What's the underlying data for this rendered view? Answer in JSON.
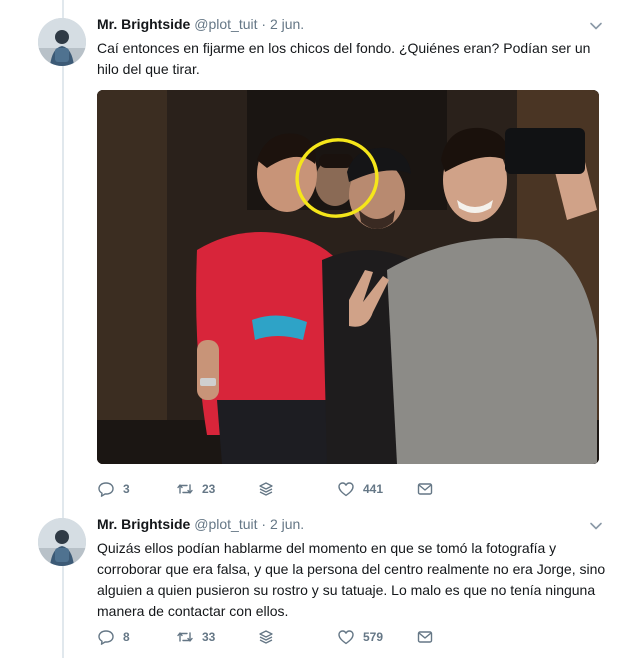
{
  "tweets": [
    {
      "author_name": "Mr. Brightside",
      "handle": "@plot_tuit",
      "separator": "·",
      "date": "2 jun.",
      "text": "Caí entonces en fijarme en los chicos del fondo. ¿Quiénes eran? Podían ser un hilo del que tirar.",
      "has_photo": true,
      "replies": "3",
      "retweets": "23",
      "likes": "441"
    },
    {
      "author_name": "Mr. Brightside",
      "handle": "@plot_tuit",
      "separator": "·",
      "date": "2 jun.",
      "text": "Quizás ellos podían hablarme del momento en que se tomó la fotografía y corroborar que era falsa, y que la persona del centro realmente no era Jorge, sino alguien a quien pusieron su rostro y su tatuaje. Lo malo es que no tenía ninguna manera de contactar con ellos.",
      "has_photo": false,
      "replies": "8",
      "retweets": "33",
      "likes": "579"
    }
  ],
  "icons": {
    "reply": "reply-icon",
    "retweet": "retweet-icon",
    "stack": "layers-icon",
    "like": "heart-icon",
    "dm": "envelope-icon",
    "menu": "chevron-down-icon"
  },
  "colors": {
    "text": "#14171a",
    "secondary": "#657786",
    "thread_line": "#e1e8ed",
    "highlight_circle": "#f5e61a",
    "red_shirt": "#d8253a"
  }
}
